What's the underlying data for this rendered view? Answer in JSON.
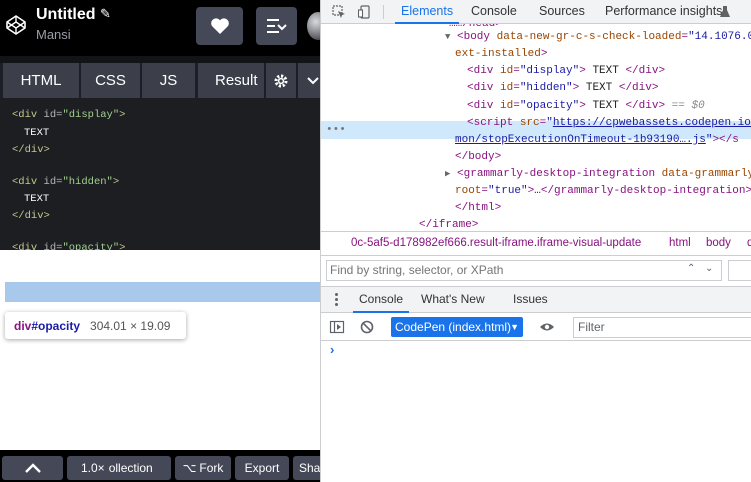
{
  "codepen": {
    "title": "Untitled",
    "pencil_icon": "✎",
    "user": "Mansi",
    "tabs": [
      {
        "label": "HTML"
      },
      {
        "label": "CSS"
      },
      {
        "label": "JS"
      },
      {
        "label": "Result"
      }
    ],
    "code_lines": [
      {
        "open": "<div",
        "attr": " id=",
        "val": "\"display\"",
        "close": ">"
      },
      {
        "text": "TEXT"
      },
      {
        "close_tag": "</div>"
      },
      {
        "open": "<div",
        "attr": " id=",
        "val": "\"hidden\"",
        "close": ">"
      },
      {
        "text": "TEXT"
      },
      {
        "close_tag": "</div>"
      },
      {
        "open": "<div",
        "attr": " id=",
        "val": "\"opacity\"",
        "close": ">"
      }
    ],
    "tooltip": {
      "tag": "div",
      "id": "#opacity",
      "size": "304.01 × 19.09"
    },
    "footer": {
      "zoom": "1.0×",
      "collection": "ollection",
      "fork_icon": "⌥",
      "fork": "Fork",
      "export": "Export",
      "share": "Sha"
    }
  },
  "devtools": {
    "tabs": [
      {
        "label": "Elements",
        "active": true
      },
      {
        "label": "Console",
        "active": false
      },
      {
        "label": "Sources",
        "active": false
      },
      {
        "label": "Performance insights",
        "active": false
      }
    ],
    "dom": {
      "body_attr": "data-new-gr-c-s-check-loaded",
      "body_val": "\"14.1076.0\"",
      "body_attr2_tail": "ext-installed",
      "nodes": [
        {
          "id_val": "\"display\"",
          "text": "TEXT"
        },
        {
          "id_val": "\"hidden\"",
          "text": "TEXT"
        },
        {
          "id_val": "\"opacity\"",
          "text": "TEXT",
          "eq": "== $0"
        }
      ],
      "script_src_1": "https://cpwebassets.codepen.io/",
      "script_src_2": "mon/stopExecutionOnTimeout-1b93190….js",
      "grammarly_tag": "grammarly-desktop-integration",
      "grammarly_attr": "data-grammarly",
      "grammarly_root": "root",
      "grammarly_root_val": "\"true\"",
      "grammarly_close": "</grammarly-desktop-integration>",
      "body_close": "</body>",
      "html_close": "</html>",
      "iframe_close": "</iframe>",
      "ellipsis": "…"
    },
    "breadcrumbs": {
      "current": "0c-5af5-d178982ef666.result-iframe.iframe-visual-update",
      "items": [
        "html",
        "body",
        "d"
      ]
    },
    "filter_placeholder": "Find by string, selector, or XPath",
    "drawer_tabs": [
      {
        "label": "Console",
        "active": true
      },
      {
        "label": "What's New",
        "active": false
      },
      {
        "label": "Issues",
        "active": false
      }
    ],
    "context": "CodePen (index.html)",
    "console_filter": "Filter",
    "prompt": "›"
  }
}
